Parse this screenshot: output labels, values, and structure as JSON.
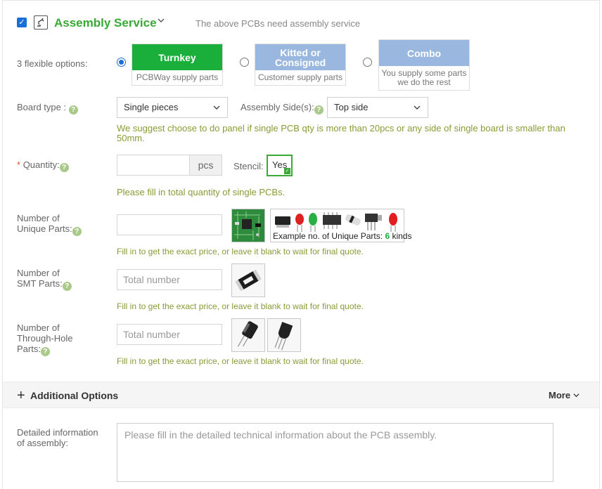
{
  "header": {
    "title": "Assembly Service",
    "note": "The above PCBs need assembly service"
  },
  "options": {
    "label": "3 flexible options:",
    "items": [
      {
        "title": "Turnkey",
        "sub": "PCBWay supply parts",
        "color": "#1aaf3a",
        "selected": true
      },
      {
        "title_line1": "Kitted or",
        "title_line2": "Consigned",
        "sub": "Customer supply parts",
        "color": "#9ab8df",
        "selected": false
      },
      {
        "title": "Combo",
        "sub_line1": "You supply some parts",
        "sub_line2": "we do the rest",
        "color": "#9ab8df",
        "selected": false
      }
    ]
  },
  "board_type": {
    "label": "Board type :",
    "value": "Single pieces",
    "side_label": "Assembly Side(s):",
    "side_value": "Top side",
    "hint": "We suggest choose to do panel if single PCB qty is more than 20pcs or any side of single board is smaller than 50mm."
  },
  "quantity": {
    "required_mark": "*",
    "label": "Quantity:",
    "value": "",
    "unit": "pcs",
    "stencil_label": "Stencil:",
    "stencil_value": "Yes",
    "hint": "Please fill in total quantity of single PCBs."
  },
  "unique_parts": {
    "label_line1": "Number of",
    "label_line2": "Unique Parts:",
    "value": "",
    "example_prefix": "Example no. of Unique Parts:",
    "example_count": "6",
    "example_suffix": "kinds",
    "hint": "Fill in to get the exact price, or leave it blank to wait for final quote."
  },
  "smt_parts": {
    "label_line1": "Number of",
    "label_line2": "SMT Parts:",
    "placeholder": "Total number",
    "hint": "Fill in to get the exact price, or leave it blank to wait for final quote."
  },
  "through_hole": {
    "label_line1": "Number of",
    "label_line2": "Through-Hole",
    "label_line3": "Parts:",
    "placeholder": "Total number",
    "hint": "Fill in to get the exact price, or leave it blank to wait for final quote."
  },
  "additional": {
    "plus": "+",
    "title": "Additional Options",
    "more": "More"
  },
  "detailed": {
    "label_line1": "Detailed information",
    "label_line2": "of assembly:",
    "placeholder": "Please fill in the detailed technical information about the PCB assembly."
  },
  "icons": {
    "help": "?",
    "check": "✓",
    "chevron": "⌄"
  }
}
